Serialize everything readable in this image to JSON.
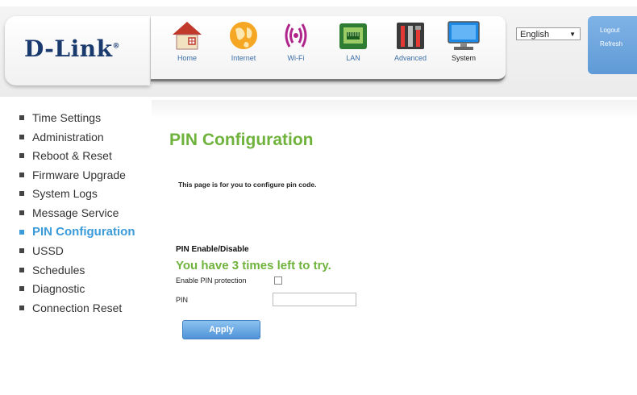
{
  "header": {
    "logo": "D-Link",
    "logo_mark": "®",
    "nav": [
      {
        "label": "Home",
        "icon": "home-icon"
      },
      {
        "label": "Internet",
        "icon": "globe-icon"
      },
      {
        "label": "Wi-Fi",
        "icon": "wifi-icon"
      },
      {
        "label": "LAN",
        "icon": "lan-icon"
      },
      {
        "label": "Advanced",
        "icon": "tools-icon"
      },
      {
        "label": "System",
        "icon": "monitor-icon"
      }
    ],
    "active_nav": "System",
    "language": "English",
    "logout_label": "Logout",
    "refresh_label": "Refresh"
  },
  "sidebar": {
    "items": [
      {
        "label": "Time Settings"
      },
      {
        "label": "Administration"
      },
      {
        "label": "Reboot & Reset"
      },
      {
        "label": "Firmware Upgrade"
      },
      {
        "label": "System Logs"
      },
      {
        "label": "Message Service"
      },
      {
        "label": "PIN Configuration"
      },
      {
        "label": "USSD"
      },
      {
        "label": "Schedules"
      },
      {
        "label": "Diagnostic"
      },
      {
        "label": "Connection Reset"
      }
    ],
    "active": "PIN Configuration"
  },
  "main": {
    "title": "PIN Configuration",
    "description": "This page is for you to configure pin code.",
    "section_title": "PIN Enable/Disable",
    "attempts_message": "You have 3 times left to try.",
    "enable_label": "Enable PIN protection",
    "enable_checked": false,
    "pin_label": "PIN",
    "pin_value": "",
    "apply_label": "Apply"
  },
  "colors": {
    "accent_green": "#6fb33d",
    "accent_blue": "#3b9bd9",
    "logo_blue": "#1a3a6e"
  }
}
